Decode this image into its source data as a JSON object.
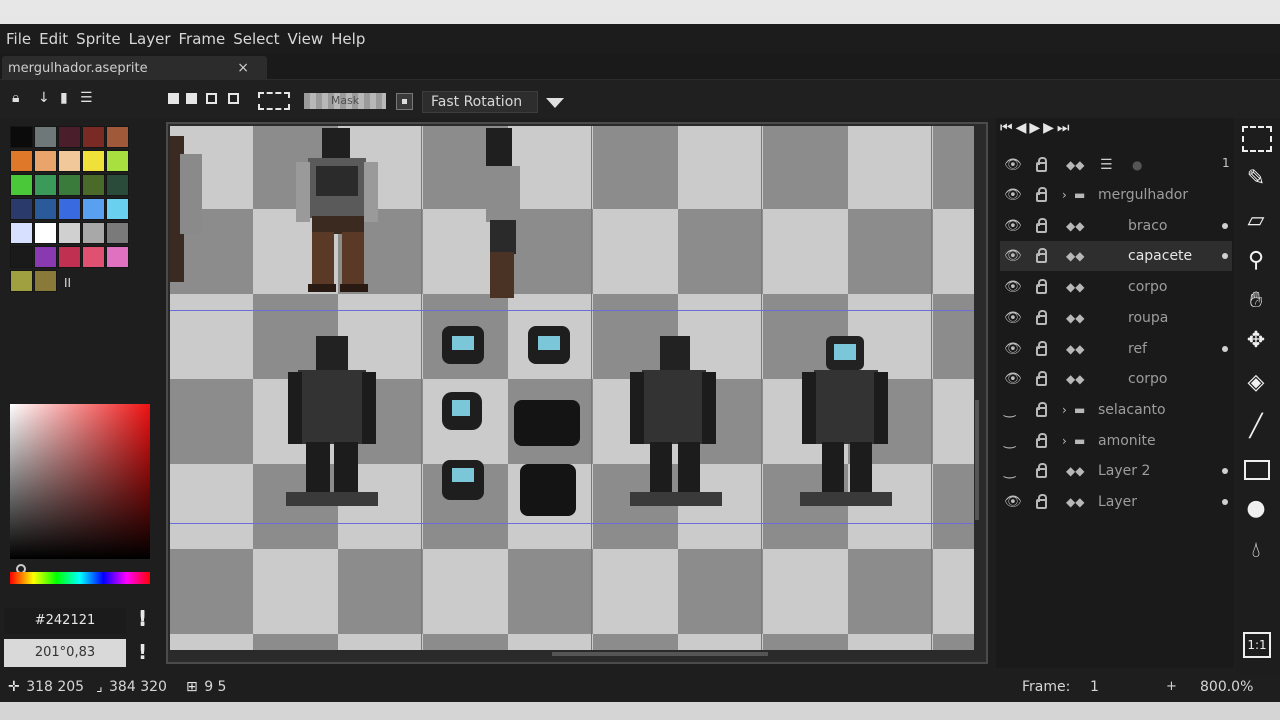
{
  "menu": [
    "File",
    "Edit",
    "Sprite",
    "Layer",
    "Frame",
    "Select",
    "View",
    "Help"
  ],
  "tab": {
    "filename": "mergulhador.aseprite",
    "close": "×"
  },
  "toolbar": {
    "rotation_mode": "Fast Rotation",
    "mask_label": "Mask"
  },
  "palette": {
    "colors": [
      "#0b0b0b",
      "#6e7878",
      "#4a1e2a",
      "#7a2a24",
      "#a05a3a",
      "#e0782a",
      "#e8a46a",
      "#f0c89a",
      "#f0e03a",
      "#a8e040",
      "#4ac83a",
      "#3a9a5a",
      "#3a7a3a",
      "#4a6a2a",
      "#2a4a3a",
      "#2a3a6a",
      "#2a5a9a",
      "#3a6ae0",
      "#5aa0f0",
      "#6ad0f0",
      "#d8e0ff",
      "#ffffff",
      "#d0d0d0",
      "#a8a8a8",
      "#7a7a7a",
      "#1a1a1a",
      "#8a3ab0",
      "#c03050",
      "#e05070",
      "#e070c0",
      "#a0a040",
      "#8a7a3a"
    ],
    "hex": "#242121",
    "hsv": "201°0,83",
    "warn": "!"
  },
  "layers": {
    "controls": "⏮◀▶▶⏭",
    "frame_number": "1",
    "rows": [
      {
        "name": "mergulhador",
        "group": true,
        "active": false,
        "indent": 0
      },
      {
        "name": "braco",
        "group": false,
        "active": false,
        "indent": 1
      },
      {
        "name": "capacete",
        "group": false,
        "active": true,
        "indent": 1
      },
      {
        "name": "corpo",
        "group": false,
        "active": false,
        "indent": 1
      },
      {
        "name": "roupa",
        "group": false,
        "active": false,
        "indent": 1
      },
      {
        "name": "ref",
        "group": false,
        "active": false,
        "indent": 1
      },
      {
        "name": "corpo",
        "group": false,
        "active": false,
        "indent": 1
      },
      {
        "name": "selacanto",
        "group": true,
        "active": false,
        "indent": 0
      },
      {
        "name": "amonite",
        "group": true,
        "active": false,
        "indent": 0
      },
      {
        "name": "Layer 2",
        "group": false,
        "active": false,
        "indent": 0
      },
      {
        "name": "Layer",
        "group": false,
        "active": false,
        "indent": 0
      }
    ]
  },
  "tools": [
    "marquee-icon",
    "pencil-icon",
    "eraser-icon",
    "eyedropper-icon",
    "hand-icon",
    "move-icon",
    "bucket-icon",
    "line-icon",
    "rectangle-icon",
    "blur-icon",
    "drop-icon",
    "ratio-icon"
  ],
  "status": {
    "cursor": "318 205",
    "size": "384 320",
    "grid": "9 5",
    "frame_label": "Frame:",
    "frame_value": "1",
    "zoom": "800.0%"
  }
}
